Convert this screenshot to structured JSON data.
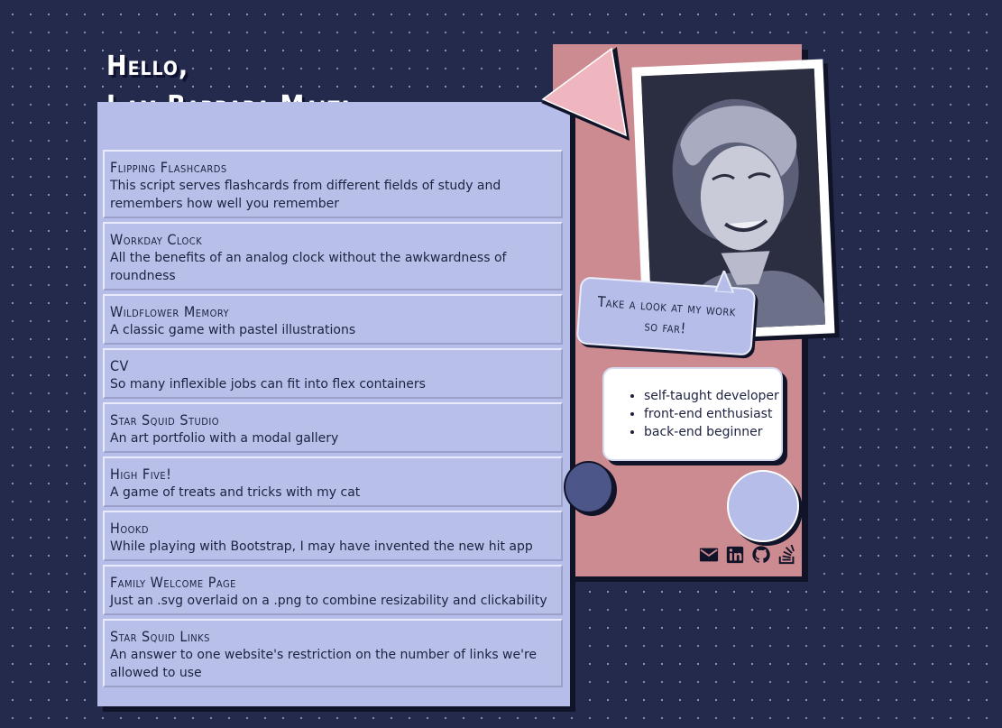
{
  "header": {
    "greeting_line1": "Hello,",
    "greeting_line2": "I am Barbara Malta"
  },
  "projects": [
    {
      "title": "Flipping Flashcards",
      "description": "This script serves flashcards from different fields of study and remembers how well you remember"
    },
    {
      "title": "Workday Clock",
      "description": "All the benefits of an analog clock without the awkwardness of roundness"
    },
    {
      "title": "Wildflower Memory",
      "description": "A classic game with pastel illustrations"
    },
    {
      "title": "CV",
      "description": "So many inflexible jobs can fit into flex containers"
    },
    {
      "title": "Star Squid Studio",
      "description": "An art portfolio with a modal gallery"
    },
    {
      "title": "High Five!",
      "description": "A game of treats and tricks with my cat"
    },
    {
      "title": "Hookd",
      "description": "While playing with Bootstrap, I may have invented the new hit app"
    },
    {
      "title": "Family Welcome Page",
      "description": "Just an .svg overlaid on a .png to combine resizability and clickability"
    },
    {
      "title": "Star Squid Links",
      "description": "An answer to one website's restriction on the number of links we're allowed to use"
    }
  ],
  "speech_bubble": {
    "line1": "Take a look at my work",
    "line2": "so far!"
  },
  "traits": [
    "self-taught developer",
    "front-end enthusiast",
    "back-end beginner"
  ],
  "socials": [
    "email-icon",
    "linkedin-icon",
    "github-icon",
    "stackoverflow-icon"
  ],
  "colors": {
    "background": "#232a4c",
    "panel_lavender": "#b5bde8",
    "panel_pink": "#cc8b91",
    "triangle_pink": "#efb6bf",
    "circle_dark": "#4c5688",
    "text_dark": "#1d2240",
    "shadow": "#111429"
  }
}
